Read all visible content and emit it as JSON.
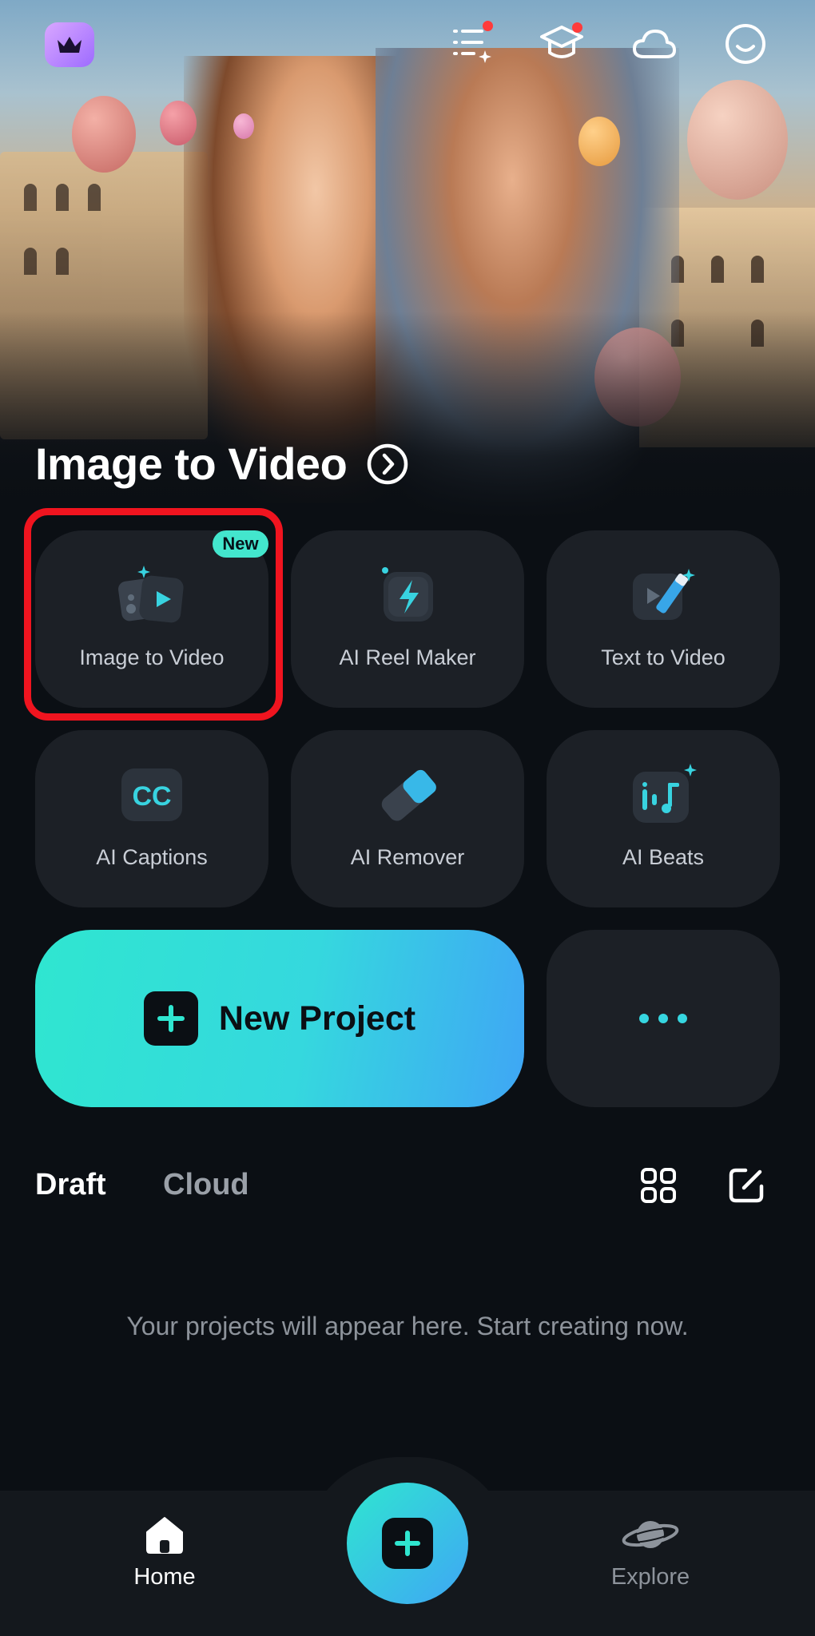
{
  "hero": {
    "title": "Image to Video"
  },
  "top_bar": {
    "icons": [
      "crown-icon",
      "tasks-icon",
      "learn-icon",
      "cloud-icon",
      "profile-icon"
    ]
  },
  "tools": [
    {
      "label": "Image to Video",
      "icon": "image-to-video-icon",
      "badge": "New"
    },
    {
      "label": "AI Reel Maker",
      "icon": "lightning-icon"
    },
    {
      "label": "Text to Video",
      "icon": "text-to-video-icon"
    },
    {
      "label": "AI Captions",
      "icon": "cc-icon"
    },
    {
      "label": "AI Remover",
      "icon": "eraser-icon"
    },
    {
      "label": "AI Beats",
      "icon": "music-icon"
    }
  ],
  "new_project": {
    "label": "New Project"
  },
  "projects": {
    "tabs": [
      "Draft",
      "Cloud"
    ],
    "active_tab": "Draft",
    "empty_message": "Your projects will appear here. Start creating now."
  },
  "bottom_nav": {
    "items": [
      {
        "label": "Home",
        "icon": "home-icon"
      },
      {
        "label": "Explore",
        "icon": "planet-icon"
      }
    ],
    "active": "Home"
  },
  "colors": {
    "accent_start": "#2fe6d0",
    "accent_end": "#3fa6f5",
    "highlight": "#f0141f",
    "badge": "#43e6cd"
  }
}
